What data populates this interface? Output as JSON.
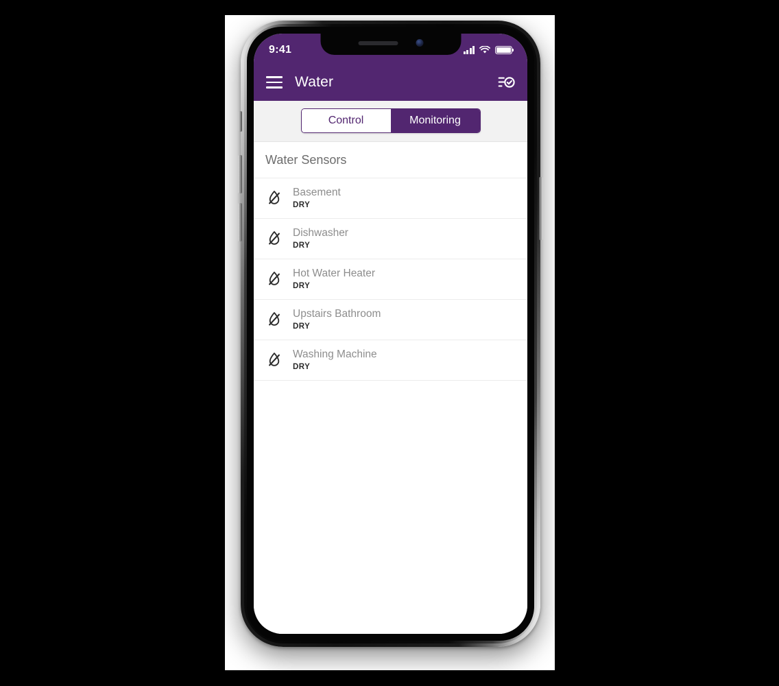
{
  "theme": {
    "brand_purple": "#522670",
    "tab_strip_bg": "#f2f2f2",
    "screen_bg": "#ffffff",
    "sensor_name_color": "#8d8d8d",
    "state_color": "#2b2b2b"
  },
  "status_bar": {
    "time": "9:41",
    "signal_icon": "cellular-signal-icon",
    "wifi_icon": "wifi-icon",
    "battery_icon": "battery-full-icon"
  },
  "app_bar": {
    "menu_icon": "hamburger-menu-icon",
    "title": "Water",
    "action_icon": "checklist-check-icon"
  },
  "tabs": [
    {
      "label": "Control",
      "selected": false
    },
    {
      "label": "Monitoring",
      "selected": true
    }
  ],
  "section": {
    "title": "Water Sensors"
  },
  "sensors": [
    {
      "name": "Basement",
      "state": "DRY",
      "icon": "water-off-icon"
    },
    {
      "name": "Dishwasher",
      "state": "DRY",
      "icon": "water-off-icon"
    },
    {
      "name": "Hot Water Heater",
      "state": "DRY",
      "icon": "water-off-icon"
    },
    {
      "name": "Upstairs Bathroom",
      "state": "DRY",
      "icon": "water-off-icon"
    },
    {
      "name": "Washing Machine",
      "state": "DRY",
      "icon": "water-off-icon"
    }
  ]
}
